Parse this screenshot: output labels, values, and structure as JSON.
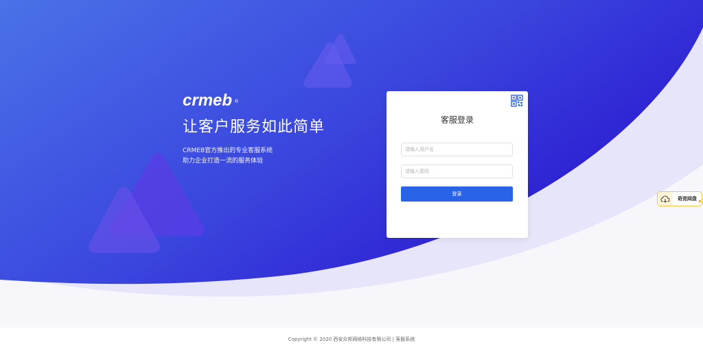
{
  "brand": {
    "logo_text": "crmeb",
    "logo_mark": "®",
    "slogan": "让客户服务如此简单",
    "desc_line1": "CRMEB官方推出的专业客服系统",
    "desc_line2": "助力企业打造一流的服务体验"
  },
  "login": {
    "title": "客服登录",
    "username_placeholder": "请输入用户名",
    "password_placeholder": "请输入密码",
    "submit_label": "登录",
    "qr_icon": "qr-code-icon"
  },
  "float_widget": {
    "label": "奇竞网盘",
    "icon": "cloud-icon"
  },
  "footer": {
    "copyright": "Copyright © 2020 西安众邦网络科技有限公司 | 客服系统"
  },
  "colors": {
    "primary": "#2a64e6",
    "hero_gradient_start": "#4c6de6",
    "hero_gradient_end": "#2b19d4",
    "page_bg": "#f6f6fb"
  }
}
